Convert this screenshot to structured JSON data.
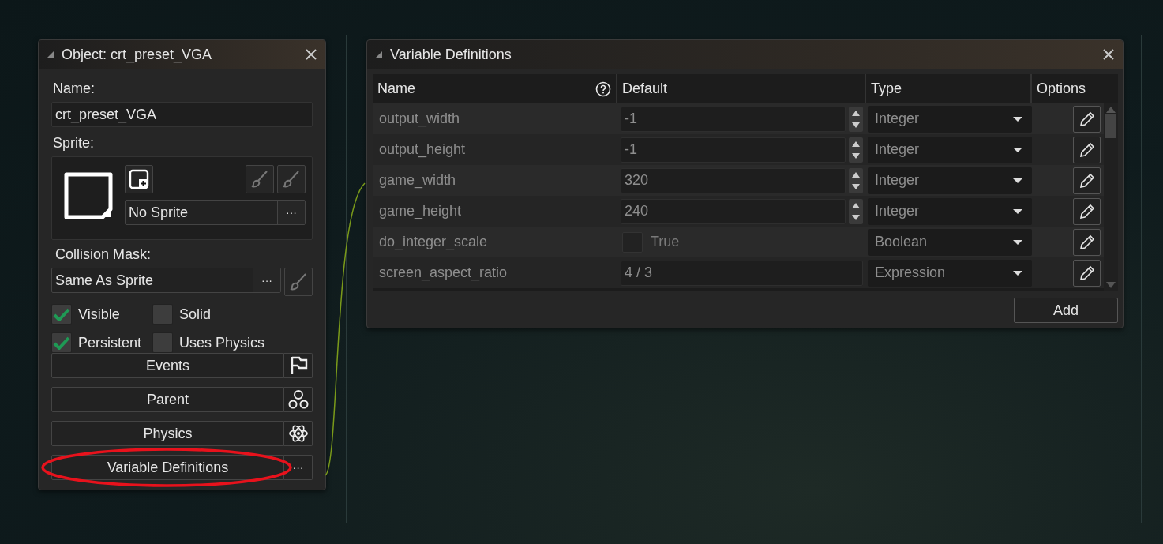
{
  "object_panel": {
    "title": "Object: crt_preset_VGA",
    "name_label": "Name:",
    "name_value": "crt_preset_VGA",
    "sprite_label": "Sprite:",
    "sprite_value": "No Sprite",
    "sprite_menu": "···",
    "collision_label": "Collision Mask:",
    "collision_value": "Same As Sprite",
    "collision_menu": "···",
    "checkboxes": [
      {
        "label": "Visible",
        "checked": true
      },
      {
        "label": "Solid",
        "checked": false
      },
      {
        "label": "Persistent",
        "checked": true
      },
      {
        "label": "Uses Physics",
        "checked": false
      }
    ],
    "buttons": [
      {
        "label": "Events",
        "kind": "flag",
        "highlighted": false
      },
      {
        "label": "Parent",
        "kind": "parent",
        "highlighted": false
      },
      {
        "label": "Physics",
        "kind": "atom",
        "highlighted": false
      },
      {
        "label": "Variable Definitions",
        "kind": "menu",
        "menu_text": "···",
        "highlighted": true
      }
    ]
  },
  "variables_panel": {
    "title": "Variable Definitions",
    "columns": [
      "Name",
      "Default",
      "Type",
      "Options"
    ],
    "rows": [
      {
        "name": "output_width",
        "kind": "number",
        "default": "-1",
        "type": "Integer"
      },
      {
        "name": "output_height",
        "kind": "number",
        "default": "-1",
        "type": "Integer"
      },
      {
        "name": "game_width",
        "kind": "number",
        "default": "320",
        "type": "Integer"
      },
      {
        "name": "game_height",
        "kind": "number",
        "default": "240",
        "type": "Integer"
      },
      {
        "name": "do_integer_scale",
        "kind": "boolean",
        "checked": false,
        "default": "True",
        "type": "Boolean"
      },
      {
        "name": "screen_aspect_ratio",
        "kind": "expression",
        "default": "4 / 3",
        "type": "Expression"
      }
    ],
    "add_button": "Add"
  }
}
